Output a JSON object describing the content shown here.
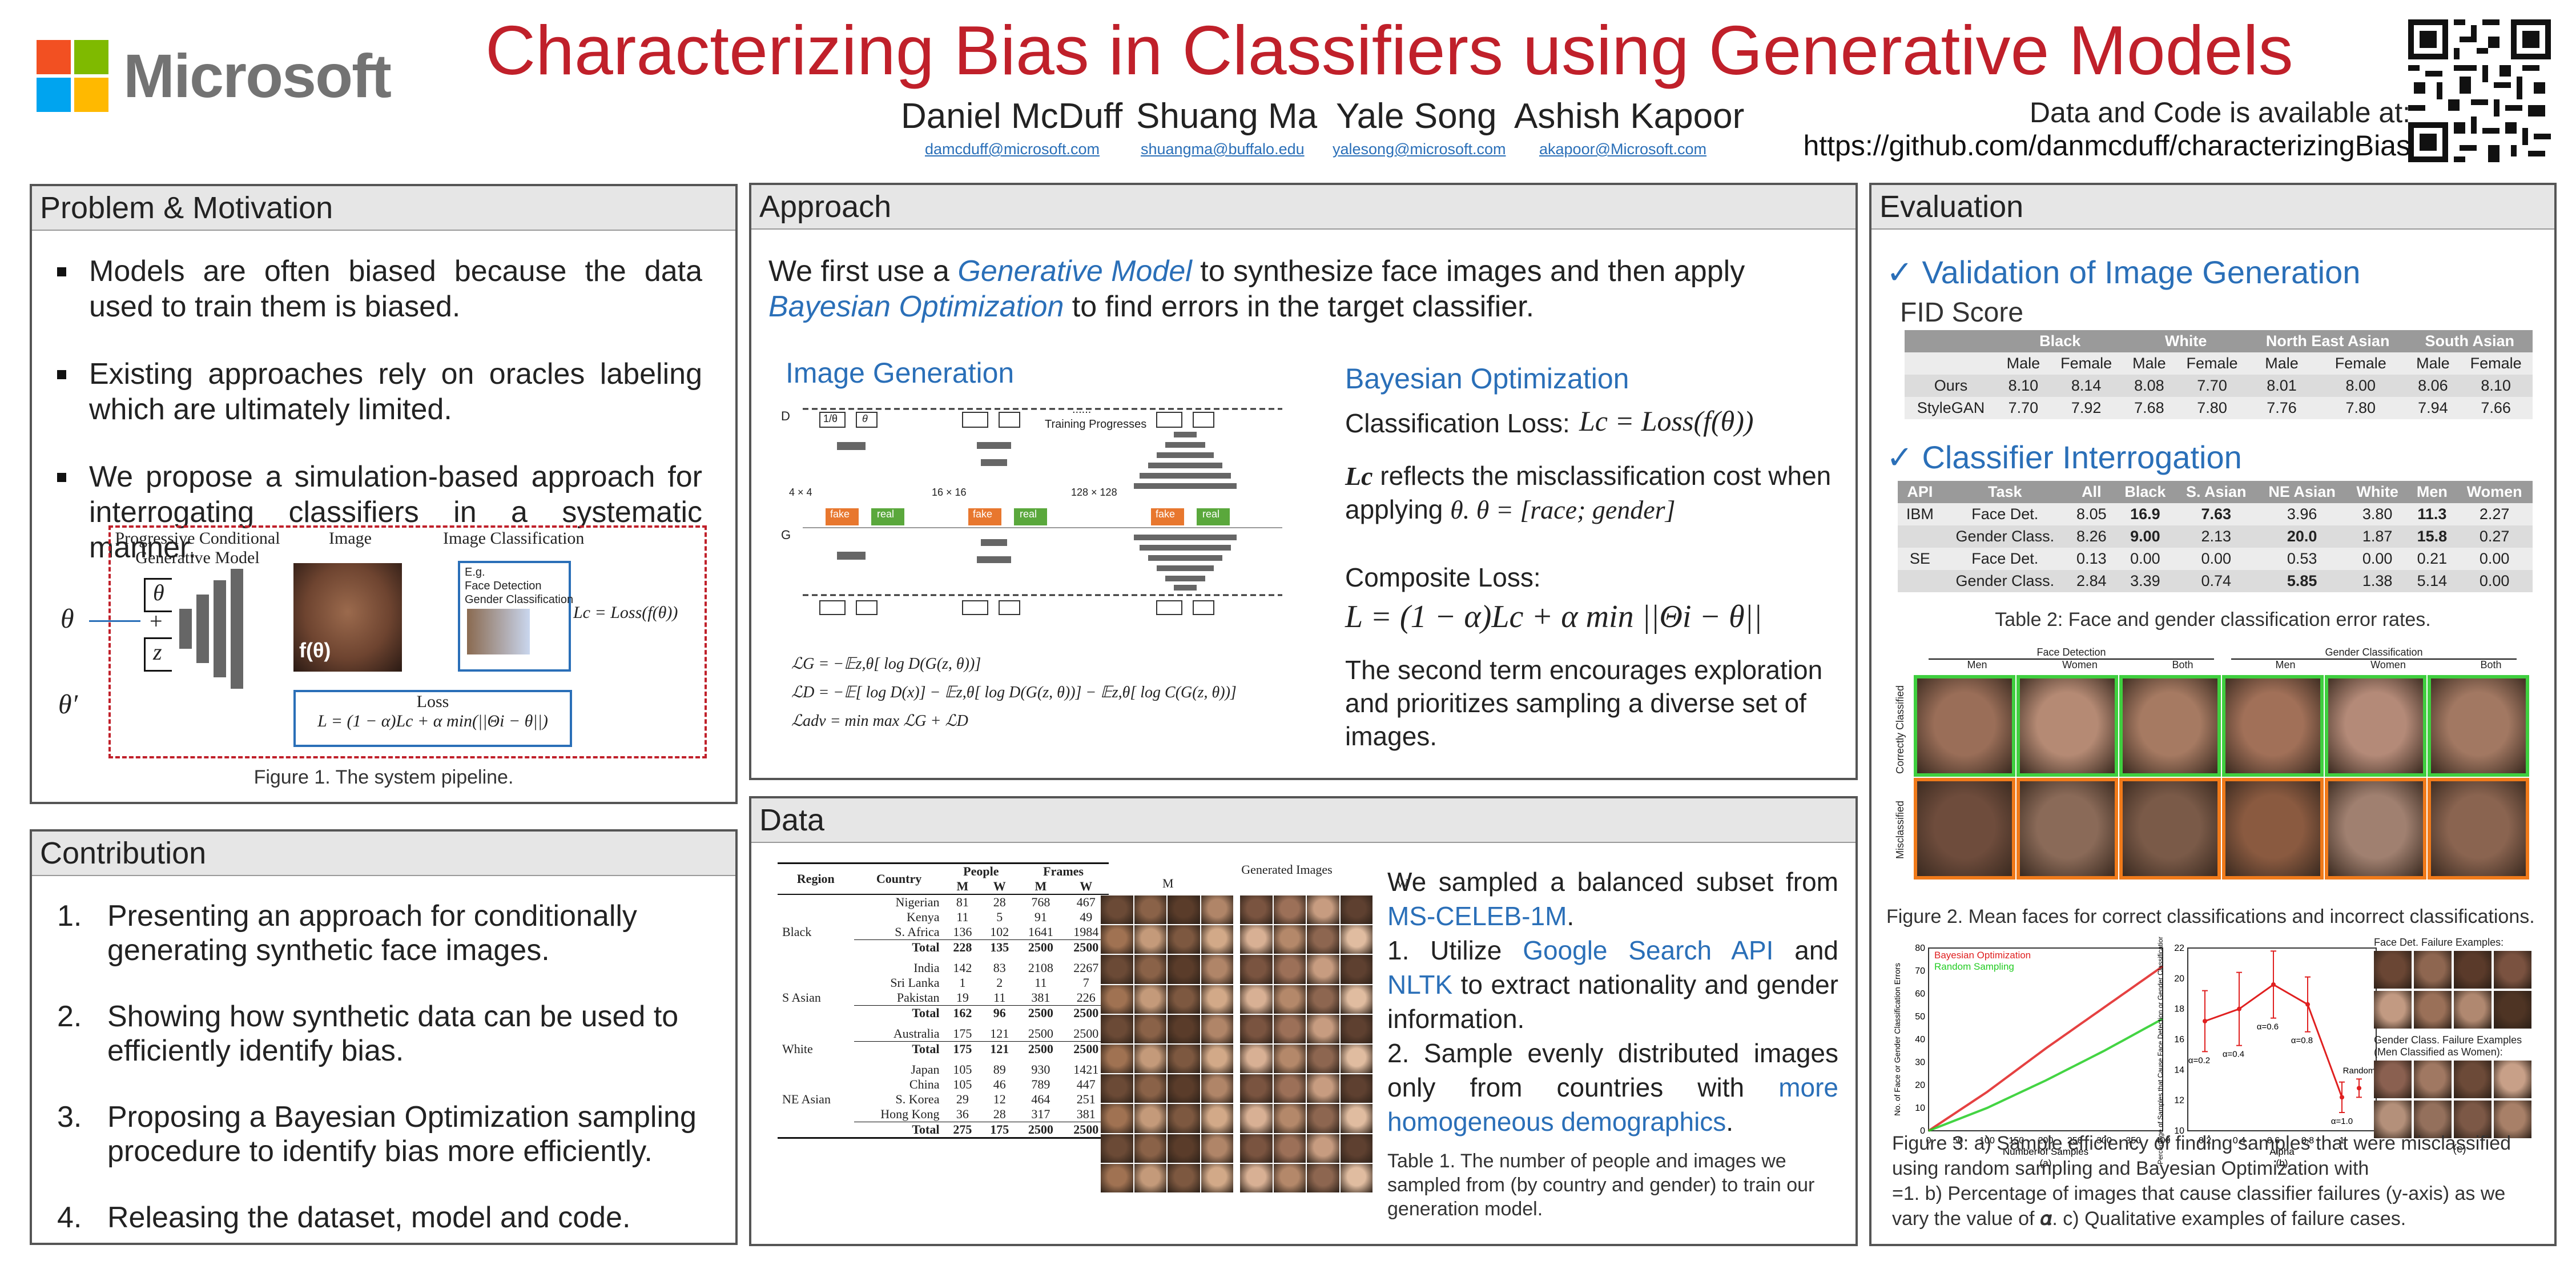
{
  "header": {
    "logo_text": "Microsoft",
    "title": "Characterizing Bias in Classifiers using Generative Models",
    "authors": [
      {
        "name": "Daniel McDuff",
        "email": "damcduff@microsoft.com"
      },
      {
        "name": "Shuang Ma",
        "email": "shuangma@buffalo.edu"
      },
      {
        "name": "Yale Song",
        "email": "yalesong@microsoft.com"
      },
      {
        "name": "Ashish Kapoor",
        "email": "akapoor@Microsoft.com"
      }
    ],
    "code_line1": "Data and Code is available at:",
    "code_line2": "https://github.com/danmcduff/characterizingBias"
  },
  "colors": {
    "title": "#c0202a",
    "accent_blue": "#2a6fb8",
    "logo_red": "#f25022",
    "logo_green": "#7fba00",
    "logo_blue": "#00a4ef",
    "logo_yellow": "#ffb900"
  },
  "problem": {
    "heading": "Problem & Motivation",
    "bullets": [
      "Models are often biased because the data used to train them is biased.",
      "Existing approaches rely on oracles labeling which are ultimately limited.",
      "We propose a simulation-based approach for interrogating classifiers in a systematic manner."
    ],
    "fig": {
      "label_pcgm": "Progressive Conditional Generative Model",
      "label_image": "Image",
      "label_class": "Image Classification",
      "theta": "θ",
      "theta_prime": "θ′",
      "z": "z",
      "plus": "+",
      "f_theta": "f(θ)",
      "eg1": "E.g.",
      "eg2": "Face Detection",
      "eg3": "Gender Classification",
      "lc_eq": "Lc = Loss(f(θ))",
      "loss_title": "Loss",
      "loss_eq": "L = (1 − α)Lc + α min(||Θi − θ||)"
    },
    "caption": "Figure 1. The system pipeline."
  },
  "contribution": {
    "heading": "Contribution",
    "items": [
      {
        "n": "1.",
        "text": "Presenting an approach for conditionally generating synthetic face images."
      },
      {
        "n": "2.",
        "text": "Showing how synthetic data can be used to efficiently identify bias."
      },
      {
        "n": "3.",
        "text": "Proposing a Bayesian Optimization sampling procedure to identify bias more efficiently."
      },
      {
        "n": "4.",
        "text": "Releasing the dataset, model and code."
      }
    ]
  },
  "approach": {
    "heading": "Approach",
    "intro_a": "We first use a ",
    "intro_gm": "Generative Model",
    "intro_b": " to synthesize face images and then apply ",
    "intro_bo": "Bayesian Optimization",
    "intro_c": " to find errors in the target classifier.",
    "img_gen_title": "Image Generation",
    "gan": {
      "d": "D",
      "g": "G",
      "fake": "fake",
      "real": "real",
      "one_over": "1/θ",
      "theta": "θ",
      "z": "z",
      "res1": "4 × 4",
      "res2": "16 × 16",
      "res3": "128 × 128",
      "training": "Training Progresses",
      "dots": "......"
    },
    "eqs": [
      "ℒG = −𝔼z,θ[ log D(G(z, θ))]",
      "ℒD = −𝔼[ log D(x)] − 𝔼z,θ[ log D(G(z, θ))] − 𝔼z,θ[ log C(G(z, θ))]",
      "ℒadv = min max ℒG + ℒD"
    ],
    "bo_title": "Bayesian Optimization",
    "class_loss_label": "Classification Loss:",
    "class_loss_eq": "Lc = Loss(f(θ))",
    "lc_line_a": "Lc",
    "lc_line_b": " reflects the misclassification cost when applying ",
    "lc_line_c": "θ. θ = [race; gender]",
    "composite_label": "Composite Loss:",
    "composite_eq": "L = (1 − α)Lc + α min ||Θi − θ||",
    "second_term": "The second term encourages exploration and prioritizes sampling a diverse set of images."
  },
  "data": {
    "heading": "Data",
    "table_headers": {
      "region": "Region",
      "country": "Country",
      "people": "People",
      "frames": "Frames",
      "generated": "Generated Images",
      "m": "M",
      "w": "W"
    },
    "groups": [
      {
        "region": "Black",
        "rows": [
          [
            "Nigerian",
            "81",
            "28",
            "768",
            "467"
          ],
          [
            "Kenya",
            "11",
            "5",
            "91",
            "49"
          ],
          [
            "S. Africa",
            "136",
            "102",
            "1641",
            "1984"
          ],
          [
            "Total",
            "228",
            "135",
            "2500",
            "2500"
          ]
        ]
      },
      {
        "region": "S Asian",
        "rows": [
          [
            "India",
            "142",
            "83",
            "2108",
            "2267"
          ],
          [
            "Sri Lanka",
            "1",
            "2",
            "11",
            "7"
          ],
          [
            "Pakistan",
            "19",
            "11",
            "381",
            "226"
          ],
          [
            "Total",
            "162",
            "96",
            "2500",
            "2500"
          ]
        ]
      },
      {
        "region": "White",
        "rows": [
          [
            "Australia",
            "175",
            "121",
            "2500",
            "2500"
          ],
          [
            "Total",
            "175",
            "121",
            "2500",
            "2500"
          ]
        ]
      },
      {
        "region": "NE Asian",
        "rows": [
          [
            "Japan",
            "105",
            "89",
            "930",
            "1421"
          ],
          [
            "China",
            "105",
            "46",
            "789",
            "447"
          ],
          [
            "S. Korea",
            "29",
            "12",
            "464",
            "251"
          ],
          [
            "Hong Kong",
            "36",
            "28",
            "317",
            "381"
          ],
          [
            "Total",
            "275",
            "175",
            "2500",
            "2500"
          ]
        ]
      }
    ],
    "text_a": "We sampled a balanced subset from ",
    "text_ms": "MS-CELEB-1M",
    "text_b": ".",
    "text_c": "1. Utilize ",
    "text_gsa": "Google Search API",
    "text_d": " and ",
    "text_nltk": "NLTK",
    "text_e": " to extract nationality and gender information.",
    "text_f": "2. Sample evenly distributed images only from countries with ",
    "text_more": "more homogeneous demographics",
    "text_g": ".",
    "caption": "Table 1. The number of people and images we sampled from (by country and gender) to train our generation model."
  },
  "evaluation": {
    "heading": "Evaluation",
    "check": "✓",
    "val_title": "Validation of Image Generation",
    "fid_label": "FID Score",
    "fid": {
      "groups": [
        "Black",
        "White",
        "North East Asian",
        "South Asian"
      ],
      "sub": [
        "Male",
        "Female"
      ],
      "rows": [
        [
          "Ours",
          "8.10",
          "8.14",
          "8.08",
          "7.70",
          "8.01",
          "8.00",
          "8.06",
          "8.10"
        ],
        [
          "StyleGAN",
          "7.70",
          "7.92",
          "7.68",
          "7.80",
          "7.76",
          "7.80",
          "7.94",
          "7.66"
        ]
      ]
    },
    "ci_title": "Classifier Interrogation",
    "ci": {
      "headers": [
        "API",
        "Task",
        "All",
        "Black",
        "S. Asian",
        "NE Asian",
        "White",
        "Men",
        "Women"
      ],
      "rows": [
        [
          "IBM",
          "Face Det.",
          "8.05",
          "16.9",
          "7.63",
          "3.96",
          "3.80",
          "11.3",
          "2.27"
        ],
        [
          "",
          "Gender Class.",
          "8.26",
          "9.00",
          "2.13",
          "20.0",
          "1.87",
          "15.8",
          "0.27"
        ],
        [
          "SE",
          "Face Det.",
          "0.13",
          "0.00",
          "0.00",
          "0.53",
          "0.00",
          "0.21",
          "0.00"
        ],
        [
          "",
          "Gender Class.",
          "2.84",
          "3.39",
          "0.74",
          "5.85",
          "1.38",
          "5.14",
          "0.00"
        ]
      ]
    },
    "table2_caption": "Table 2: Face and gender classification error rates.",
    "mean_faces": {
      "face_det": "Face Detection",
      "gender_class": "Gender Classification",
      "cols": [
        "Men",
        "Women",
        "Both",
        "Men",
        "Women",
        "Both"
      ],
      "row1": "Correctly Classified",
      "row2": "Misclassified"
    },
    "fig2_caption": "Figure 2. Mean faces for correct classifications and incorrect classifications.",
    "fig3": {
      "ylabel_a": "No. of Face or Gender Classification Errors",
      "xlabel_a": "Number of Samples",
      "sub_a": "(a)",
      "legend_bo": "Bayesian Optimization",
      "legend_rs": "Random Sampling",
      "ylabel_b": "Percentage of Samples that Cause Face Detection or Gender Classification Errors",
      "xlabel_b": "Alpha",
      "sub_b": "(b)",
      "random_label": "Random",
      "alpha_labels": [
        "α=0.2",
        "α=0.4",
        "α=0.6",
        "α=0.8",
        "α=1.0"
      ],
      "fd_fail": "Face Det. Failure Examples:",
      "gc_fail1": "Gender Class. Failure Examples",
      "gc_fail2": "(Men Classified as Women):",
      "sub_c": "(c)"
    },
    "fig3_caption_a": "Figure 3: a) Sample efficiency of finding samples that were misclassified using random sampling and Bayesian Optimization with",
    "fig3_caption_b": "=1. b) Percentage of images that cause classifier failures (y-axis) as we vary the value of 𝜶. c) Qualitative examples of failure cases."
  },
  "chart_data": [
    {
      "type": "line",
      "xlabel": "Number of Samples",
      "ylabel": "No. of Face or Gender Classification Errors",
      "xlim": [
        0,
        400
      ],
      "ylim": [
        0,
        80
      ],
      "x_ticks": [
        0,
        50,
        100,
        150,
        200,
        250,
        300,
        350,
        400
      ],
      "y_ticks": [
        0,
        10,
        20,
        30,
        40,
        50,
        60,
        70,
        80
      ],
      "series": [
        {
          "name": "Bayesian Optimization",
          "color": "#e02020",
          "x": [
            0,
            100,
            200,
            300,
            400
          ],
          "values": [
            0,
            17,
            36,
            54,
            72
          ]
        },
        {
          "name": "Random Sampling",
          "color": "#22cc22",
          "x": [
            0,
            100,
            200,
            300,
            400
          ],
          "values": [
            0,
            10,
            22,
            35,
            49
          ]
        }
      ]
    },
    {
      "type": "line",
      "xlabel": "Alpha",
      "ylabel": "Percentage of Samples that Cause Face Detection or Gender Classification Errors",
      "xlim": [
        0.1,
        1.2
      ],
      "ylim": [
        10,
        22
      ],
      "x_ticks": [
        0.2,
        0.4,
        0.6,
        0.8,
        1
      ],
      "y_ticks": [
        10,
        12,
        14,
        16,
        18,
        20,
        22
      ],
      "series": [
        {
          "name": "",
          "color": "#e02020",
          "x": [
            0.2,
            0.4,
            0.6,
            0.8,
            1.0
          ],
          "values": [
            17.2,
            18.0,
            19.6,
            18.3,
            12.2
          ],
          "err": [
            2.0,
            2.4,
            2.2,
            1.8,
            1.0
          ]
        },
        {
          "name": "Random",
          "color": "#e02020",
          "x": [
            1.1
          ],
          "values": [
            12.8
          ],
          "err": [
            0.6
          ]
        }
      ]
    }
  ]
}
